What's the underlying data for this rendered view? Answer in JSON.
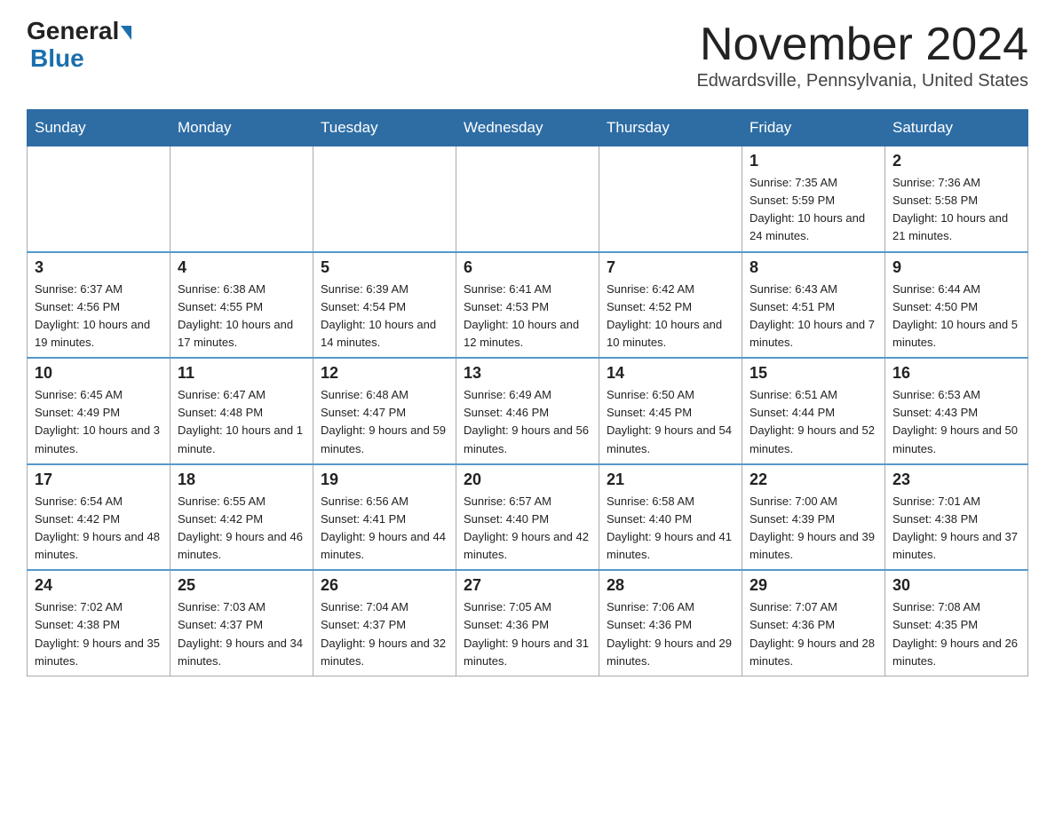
{
  "header": {
    "logo_general": "General",
    "logo_blue": "Blue",
    "month_year": "November 2024",
    "location": "Edwardsville, Pennsylvania, United States"
  },
  "days_of_week": [
    "Sunday",
    "Monday",
    "Tuesday",
    "Wednesday",
    "Thursday",
    "Friday",
    "Saturday"
  ],
  "weeks": [
    [
      {
        "day": "",
        "sunrise": "",
        "sunset": "",
        "daylight": ""
      },
      {
        "day": "",
        "sunrise": "",
        "sunset": "",
        "daylight": ""
      },
      {
        "day": "",
        "sunrise": "",
        "sunset": "",
        "daylight": ""
      },
      {
        "day": "",
        "sunrise": "",
        "sunset": "",
        "daylight": ""
      },
      {
        "day": "",
        "sunrise": "",
        "sunset": "",
        "daylight": ""
      },
      {
        "day": "1",
        "sunrise": "Sunrise: 7:35 AM",
        "sunset": "Sunset: 5:59 PM",
        "daylight": "Daylight: 10 hours and 24 minutes."
      },
      {
        "day": "2",
        "sunrise": "Sunrise: 7:36 AM",
        "sunset": "Sunset: 5:58 PM",
        "daylight": "Daylight: 10 hours and 21 minutes."
      }
    ],
    [
      {
        "day": "3",
        "sunrise": "Sunrise: 6:37 AM",
        "sunset": "Sunset: 4:56 PM",
        "daylight": "Daylight: 10 hours and 19 minutes."
      },
      {
        "day": "4",
        "sunrise": "Sunrise: 6:38 AM",
        "sunset": "Sunset: 4:55 PM",
        "daylight": "Daylight: 10 hours and 17 minutes."
      },
      {
        "day": "5",
        "sunrise": "Sunrise: 6:39 AM",
        "sunset": "Sunset: 4:54 PM",
        "daylight": "Daylight: 10 hours and 14 minutes."
      },
      {
        "day": "6",
        "sunrise": "Sunrise: 6:41 AM",
        "sunset": "Sunset: 4:53 PM",
        "daylight": "Daylight: 10 hours and 12 minutes."
      },
      {
        "day": "7",
        "sunrise": "Sunrise: 6:42 AM",
        "sunset": "Sunset: 4:52 PM",
        "daylight": "Daylight: 10 hours and 10 minutes."
      },
      {
        "day": "8",
        "sunrise": "Sunrise: 6:43 AM",
        "sunset": "Sunset: 4:51 PM",
        "daylight": "Daylight: 10 hours and 7 minutes."
      },
      {
        "day": "9",
        "sunrise": "Sunrise: 6:44 AM",
        "sunset": "Sunset: 4:50 PM",
        "daylight": "Daylight: 10 hours and 5 minutes."
      }
    ],
    [
      {
        "day": "10",
        "sunrise": "Sunrise: 6:45 AM",
        "sunset": "Sunset: 4:49 PM",
        "daylight": "Daylight: 10 hours and 3 minutes."
      },
      {
        "day": "11",
        "sunrise": "Sunrise: 6:47 AM",
        "sunset": "Sunset: 4:48 PM",
        "daylight": "Daylight: 10 hours and 1 minute."
      },
      {
        "day": "12",
        "sunrise": "Sunrise: 6:48 AM",
        "sunset": "Sunset: 4:47 PM",
        "daylight": "Daylight: 9 hours and 59 minutes."
      },
      {
        "day": "13",
        "sunrise": "Sunrise: 6:49 AM",
        "sunset": "Sunset: 4:46 PM",
        "daylight": "Daylight: 9 hours and 56 minutes."
      },
      {
        "day": "14",
        "sunrise": "Sunrise: 6:50 AM",
        "sunset": "Sunset: 4:45 PM",
        "daylight": "Daylight: 9 hours and 54 minutes."
      },
      {
        "day": "15",
        "sunrise": "Sunrise: 6:51 AM",
        "sunset": "Sunset: 4:44 PM",
        "daylight": "Daylight: 9 hours and 52 minutes."
      },
      {
        "day": "16",
        "sunrise": "Sunrise: 6:53 AM",
        "sunset": "Sunset: 4:43 PM",
        "daylight": "Daylight: 9 hours and 50 minutes."
      }
    ],
    [
      {
        "day": "17",
        "sunrise": "Sunrise: 6:54 AM",
        "sunset": "Sunset: 4:42 PM",
        "daylight": "Daylight: 9 hours and 48 minutes."
      },
      {
        "day": "18",
        "sunrise": "Sunrise: 6:55 AM",
        "sunset": "Sunset: 4:42 PM",
        "daylight": "Daylight: 9 hours and 46 minutes."
      },
      {
        "day": "19",
        "sunrise": "Sunrise: 6:56 AM",
        "sunset": "Sunset: 4:41 PM",
        "daylight": "Daylight: 9 hours and 44 minutes."
      },
      {
        "day": "20",
        "sunrise": "Sunrise: 6:57 AM",
        "sunset": "Sunset: 4:40 PM",
        "daylight": "Daylight: 9 hours and 42 minutes."
      },
      {
        "day": "21",
        "sunrise": "Sunrise: 6:58 AM",
        "sunset": "Sunset: 4:40 PM",
        "daylight": "Daylight: 9 hours and 41 minutes."
      },
      {
        "day": "22",
        "sunrise": "Sunrise: 7:00 AM",
        "sunset": "Sunset: 4:39 PM",
        "daylight": "Daylight: 9 hours and 39 minutes."
      },
      {
        "day": "23",
        "sunrise": "Sunrise: 7:01 AM",
        "sunset": "Sunset: 4:38 PM",
        "daylight": "Daylight: 9 hours and 37 minutes."
      }
    ],
    [
      {
        "day": "24",
        "sunrise": "Sunrise: 7:02 AM",
        "sunset": "Sunset: 4:38 PM",
        "daylight": "Daylight: 9 hours and 35 minutes."
      },
      {
        "day": "25",
        "sunrise": "Sunrise: 7:03 AM",
        "sunset": "Sunset: 4:37 PM",
        "daylight": "Daylight: 9 hours and 34 minutes."
      },
      {
        "day": "26",
        "sunrise": "Sunrise: 7:04 AM",
        "sunset": "Sunset: 4:37 PM",
        "daylight": "Daylight: 9 hours and 32 minutes."
      },
      {
        "day": "27",
        "sunrise": "Sunrise: 7:05 AM",
        "sunset": "Sunset: 4:36 PM",
        "daylight": "Daylight: 9 hours and 31 minutes."
      },
      {
        "day": "28",
        "sunrise": "Sunrise: 7:06 AM",
        "sunset": "Sunset: 4:36 PM",
        "daylight": "Daylight: 9 hours and 29 minutes."
      },
      {
        "day": "29",
        "sunrise": "Sunrise: 7:07 AM",
        "sunset": "Sunset: 4:36 PM",
        "daylight": "Daylight: 9 hours and 28 minutes."
      },
      {
        "day": "30",
        "sunrise": "Sunrise: 7:08 AM",
        "sunset": "Sunset: 4:35 PM",
        "daylight": "Daylight: 9 hours and 26 minutes."
      }
    ]
  ]
}
